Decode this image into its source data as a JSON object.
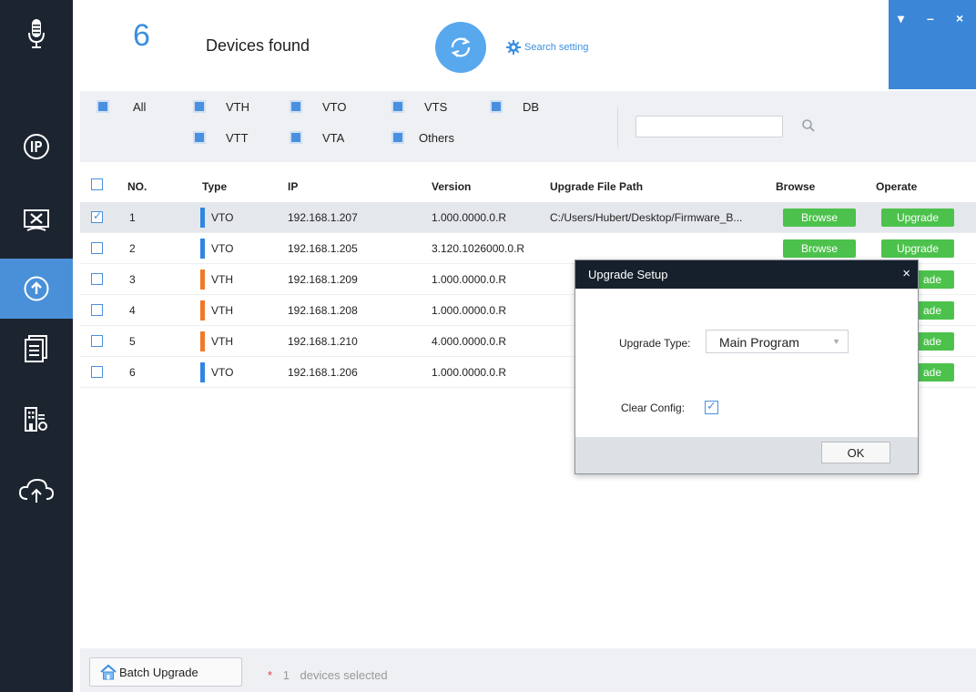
{
  "header": {
    "device_count": "6",
    "devices_found_label": "Devices found",
    "search_setting_label": "Search setting"
  },
  "filters": {
    "items": [
      {
        "label": "All"
      },
      {
        "label": "VTH"
      },
      {
        "label": "VTO"
      },
      {
        "label": "VTS"
      },
      {
        "label": "DB"
      },
      {
        "label": "VTT"
      },
      {
        "label": "VTA"
      },
      {
        "label": "Others"
      }
    ],
    "search_value": ""
  },
  "table": {
    "columns": {
      "no": "NO.",
      "type": "Type",
      "ip": "IP",
      "version": "Version",
      "path": "Upgrade File Path",
      "browse": "Browse",
      "operate": "Operate"
    },
    "rows": [
      {
        "no": "1",
        "type": "VTO",
        "ip": "192.168.1.207",
        "version": "1.000.0000.0.R",
        "path": "C:/Users/Hubert/Desktop/Firmware_B...",
        "browse": "Browse",
        "operate": "Upgrade",
        "checked": true
      },
      {
        "no": "2",
        "type": "VTO",
        "ip": "192.168.1.205",
        "version": "3.120.1026000.0.R",
        "path": "",
        "browse": "Browse",
        "operate": "Upgrade",
        "checked": false
      },
      {
        "no": "3",
        "type": "VTH",
        "ip": "192.168.1.209",
        "version": "1.000.0000.0.R",
        "path": "",
        "browse": "",
        "operate": "ade",
        "checked": false
      },
      {
        "no": "4",
        "type": "VTH",
        "ip": "192.168.1.208",
        "version": "1.000.0000.0.R",
        "path": "",
        "browse": "",
        "operate": "ade",
        "checked": false
      },
      {
        "no": "5",
        "type": "VTH",
        "ip": "192.168.1.210",
        "version": "4.000.0000.0.R",
        "path": "",
        "browse": "",
        "operate": "ade",
        "checked": false
      },
      {
        "no": "6",
        "type": "VTO",
        "ip": "192.168.1.206",
        "version": "1.000.0000.0.R",
        "path": "",
        "browse": "",
        "operate": "ade",
        "checked": false
      }
    ]
  },
  "dialog": {
    "title": "Upgrade Setup",
    "close": "×",
    "upgrade_type_label": "Upgrade Type:",
    "upgrade_type_value": "Main Program",
    "clear_config_label": "Clear Config:",
    "clear_config_checked": true,
    "ok_label": "OK"
  },
  "footer": {
    "batch_upgrade_label": "Batch Upgrade",
    "star": "*",
    "selected_count": "1",
    "selected_text": "devices selected"
  },
  "colors": {
    "accent": "#3d8fe0",
    "vto": "#2f86e0",
    "vth": "#f07a2a",
    "green": "#4cc24c",
    "sidebar": "#1c2430"
  },
  "sidebar_icons": [
    "microphone-icon",
    "ip-icon",
    "tools-icon",
    "upgrade-icon",
    "documents-icon",
    "building-settings-icon",
    "cloud-upload-icon"
  ]
}
